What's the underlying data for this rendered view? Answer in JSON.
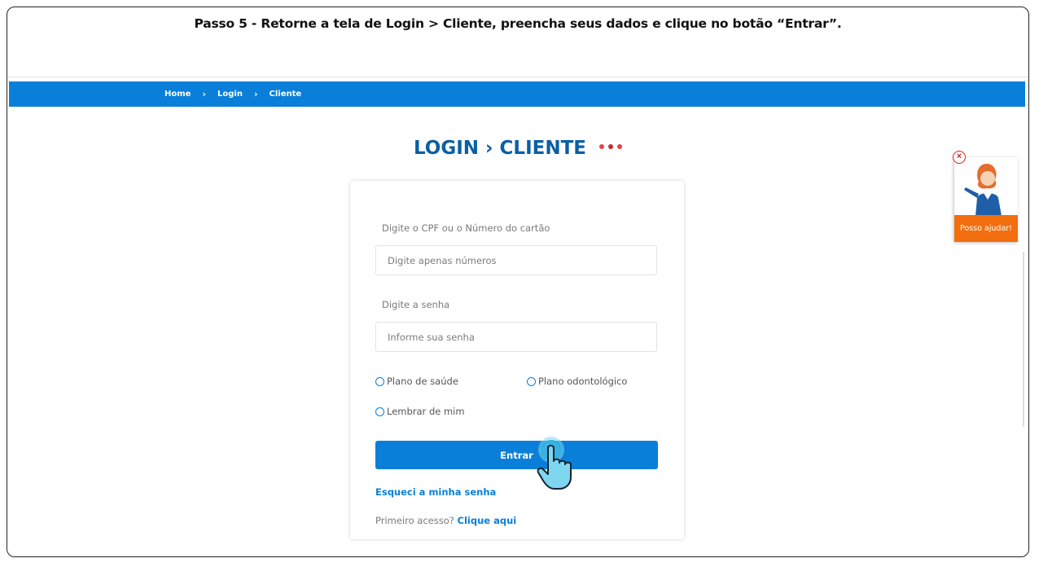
{
  "caption": "Passo 5 - Retorne a tela de Login > Cliente, preencha seus dados e clique no botão “Entrar”.",
  "breadcrumb": {
    "home": "Home",
    "login": "Login",
    "cliente": "Cliente",
    "separator": "›"
  },
  "page_title": "LOGIN › CLIENTE",
  "colors": {
    "brand_blue": "#0a7fd9",
    "title_blue": "#0a5fa6",
    "help_orange": "#f26e0f",
    "dot_colors": [
      "#e0454b",
      "#c52a2f",
      "#e0454b"
    ]
  },
  "form": {
    "cpf_label": "Digite o CPF ou o Número do cartão",
    "cpf_placeholder": "Digite apenas números",
    "password_label": "Digite a senha",
    "password_placeholder": "Informe sua senha",
    "radio_health": "Plano de saúde",
    "radio_dental": "Plano odontológico",
    "remember": "Lembrar de mim",
    "submit": "Entrar",
    "forgot": "Esqueci a minha senha",
    "first_access": "Primeiro acesso?",
    "click_here": "Clique aqui"
  },
  "help_widget": {
    "label": "Posso ajudar!",
    "close_icon": "close-icon"
  }
}
